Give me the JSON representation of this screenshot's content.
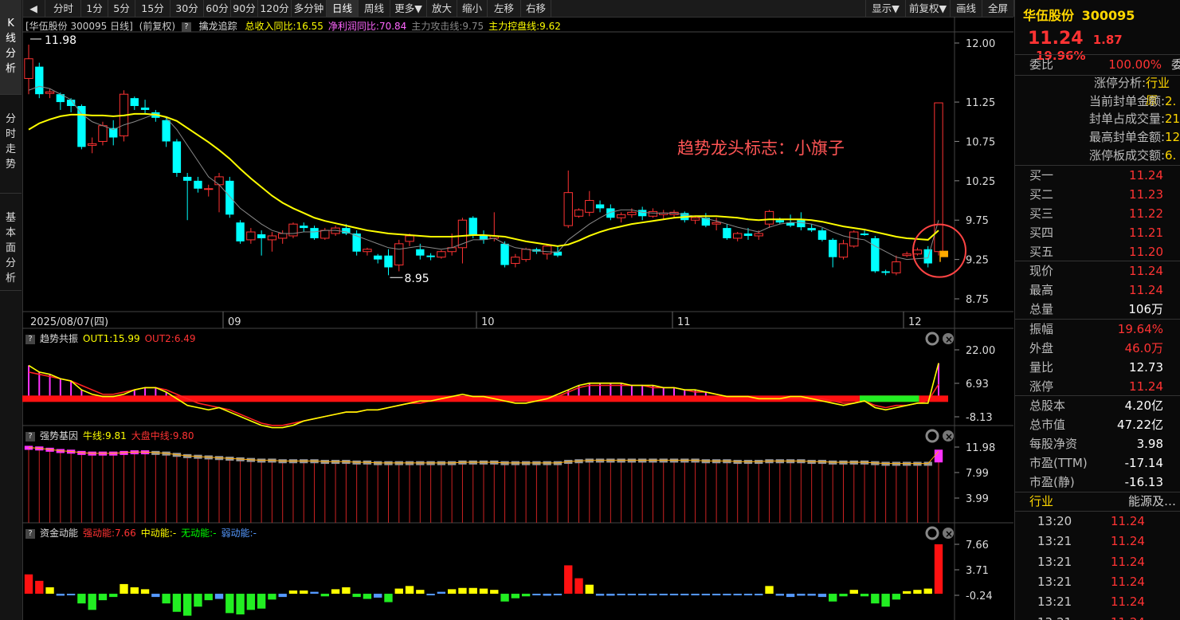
{
  "toolbar": {
    "back": "◀",
    "buttons": [
      "分时",
      "1分",
      "5分",
      "15分",
      "30分",
      "60分",
      "90分",
      "120分",
      "多分钟",
      "日线",
      "周线",
      "更多▼",
      "放大",
      "缩小",
      "左移",
      "右移"
    ],
    "right": [
      "显示▼",
      "前复权▼",
      "画线",
      "全屏"
    ]
  },
  "nav": [
    "K线分析",
    "分时走势",
    "基本面分析"
  ],
  "main_panel": {
    "title_prefix": "[华伍股份 300095 日线]",
    "adjust": "(前复权)",
    "indicator": "擒龙追踪",
    "legend": [
      {
        "text": "总收入同比:16.55",
        "color": "#ffff00"
      },
      {
        "text": "净利润同比:70.84",
        "color": "#ff66ff"
      },
      {
        "text": "主力攻击线:9.75",
        "color": "#888888"
      },
      {
        "text": "主力控盘线:9.62",
        "color": "#ffff00"
      }
    ],
    "high_label": "11.98",
    "low_label": "8.95",
    "annotation": "趋势龙头标志：小旗子",
    "date_start": "2025/08/07(四)",
    "months": [
      "09",
      "10",
      "11",
      "12"
    ],
    "yticks": [
      "12.00",
      "11.25",
      "10.75",
      "10.25",
      "9.75",
      "9.25",
      "8.75"
    ]
  },
  "panel2": {
    "title": "趋势共振",
    "legend": [
      {
        "text": "OUT1:15.99",
        "color": "#ffff00"
      },
      {
        "text": "OUT2:6.49",
        "color": "#ff3333"
      }
    ],
    "yticks": [
      "22.00",
      "6.93",
      "-8.13"
    ]
  },
  "panel3": {
    "title": "强势基因",
    "legend": [
      {
        "text": "牛线:9.81",
        "color": "#ffff00"
      },
      {
        "text": "大盘中线:9.80",
        "color": "#ff3333"
      }
    ],
    "yticks": [
      "11.98",
      "7.99",
      "3.99"
    ]
  },
  "panel4": {
    "title": "资金动能",
    "legend": [
      {
        "text": "强动能:7.66",
        "color": "#ff3333"
      },
      {
        "text": "中动能:-",
        "color": "#ffff00"
      },
      {
        "text": "无动能:-",
        "color": "#00ff00"
      },
      {
        "text": "弱动能:-",
        "color": "#5599ff"
      }
    ],
    "yticks": [
      "7.66",
      "3.71",
      "-0.24"
    ]
  },
  "quote": {
    "name": "华伍股份",
    "code": "300095",
    "price": "11.24",
    "change": "1.87",
    "pct": "19.96%",
    "weibi_label": "委比",
    "weibi": "100.00%",
    "weibi_extra": "委",
    "limit": [
      {
        "label": "涨停分析:",
        "value": "行业原"
      },
      {
        "label": "当前封单金额:",
        "value": "2."
      },
      {
        "label": "封单占成交量:",
        "value": "21"
      },
      {
        "label": "最高封单金额:",
        "value": "12"
      },
      {
        "label": "涨停板成交额:",
        "value": "6."
      }
    ],
    "bids": [
      {
        "label": "买一",
        "value": "11.24"
      },
      {
        "label": "买二",
        "value": "11.23"
      },
      {
        "label": "买三",
        "value": "11.22"
      },
      {
        "label": "买四",
        "value": "11.21"
      },
      {
        "label": "买五",
        "value": "11.20"
      }
    ],
    "stats1": [
      {
        "label": "现价",
        "value": "11.24",
        "color": "#ff3333"
      },
      {
        "label": "最高",
        "value": "11.24",
        "color": "#ff3333"
      },
      {
        "label": "总量",
        "value": "106万",
        "color": "#ffffff"
      }
    ],
    "stats2": [
      {
        "label": "振幅",
        "value": "19.64%",
        "color": "#ff3333"
      },
      {
        "label": "外盘",
        "value": "46.0万",
        "color": "#ff3333"
      },
      {
        "label": "量比",
        "value": "12.73",
        "color": "#ffffff"
      },
      {
        "label": "涨停",
        "value": "11.24",
        "color": "#ff3333"
      }
    ],
    "stats3": [
      {
        "label": "总股本",
        "value": "4.20亿"
      },
      {
        "label": "总市值",
        "value": "47.22亿"
      },
      {
        "label": "每股净资",
        "value": "3.98"
      },
      {
        "label": "市盈(TTM)",
        "value": "-17.14"
      },
      {
        "label": "市盈(静)",
        "value": "-16.13"
      }
    ],
    "industry_label": "行业",
    "industry": "能源及…",
    "ticks": [
      {
        "time": "13:20",
        "price": "11.24"
      },
      {
        "time": "13:21",
        "price": "11.24"
      },
      {
        "time": "13:21",
        "price": "11.24"
      },
      {
        "time": "13:21",
        "price": "11.24"
      },
      {
        "time": "13:21",
        "price": "11.24"
      },
      {
        "time": "13:21",
        "price": "11.24"
      }
    ]
  },
  "chart_data": {
    "type": "candlestick",
    "ohlc": [
      [
        11.55,
        11.98,
        11.35,
        11.8
      ],
      [
        11.7,
        11.75,
        11.3,
        11.35
      ],
      [
        11.36,
        11.42,
        11.3,
        11.38
      ],
      [
        11.35,
        11.37,
        11.15,
        11.25
      ],
      [
        11.28,
        11.3,
        11.12,
        11.2
      ],
      [
        11.2,
        11.22,
        10.65,
        10.68
      ],
      [
        10.7,
        10.8,
        10.6,
        10.72
      ],
      [
        10.75,
        11.0,
        10.7,
        10.95
      ],
      [
        10.92,
        11.02,
        10.7,
        10.8
      ],
      [
        10.82,
        11.4,
        10.75,
        11.35
      ],
      [
        11.3,
        11.32,
        11.15,
        11.2
      ],
      [
        11.18,
        11.28,
        11.1,
        11.15
      ],
      [
        11.12,
        11.15,
        11.0,
        11.05
      ],
      [
        11.02,
        11.05,
        10.68,
        10.75
      ],
      [
        10.75,
        10.78,
        10.3,
        10.35
      ],
      [
        10.3,
        10.35,
        9.75,
        10.25
      ],
      [
        10.25,
        10.3,
        10.1,
        10.15
      ],
      [
        10.15,
        10.2,
        10.05,
        10.15
      ],
      [
        10.2,
        10.35,
        9.85,
        10.3
      ],
      [
        10.25,
        10.3,
        9.78,
        9.82
      ],
      [
        9.72,
        9.75,
        9.45,
        9.48
      ],
      [
        9.5,
        9.65,
        9.45,
        9.6
      ],
      [
        9.57,
        9.62,
        9.3,
        9.52
      ],
      [
        9.5,
        9.6,
        9.35,
        9.55
      ],
      [
        9.52,
        9.62,
        9.45,
        9.58
      ],
      [
        9.55,
        9.72,
        9.52,
        9.7
      ],
      [
        9.68,
        9.72,
        9.6,
        9.65
      ],
      [
        9.65,
        9.68,
        9.5,
        9.52
      ],
      [
        9.52,
        9.65,
        9.5,
        9.62
      ],
      [
        9.58,
        9.68,
        9.55,
        9.65
      ],
      [
        9.65,
        9.7,
        9.56,
        9.58
      ],
      [
        9.58,
        9.62,
        9.3,
        9.35
      ],
      [
        9.35,
        9.4,
        9.3,
        9.38
      ],
      [
        9.3,
        9.32,
        9.2,
        9.25
      ],
      [
        9.3,
        9.38,
        9.05,
        9.15
      ],
      [
        9.18,
        9.5,
        9.1,
        9.45
      ],
      [
        9.48,
        9.58,
        9.42,
        9.55
      ],
      [
        9.38,
        9.45,
        9.25,
        9.3
      ],
      [
        9.3,
        9.33,
        9.24,
        9.28
      ],
      [
        9.28,
        9.37,
        9.26,
        9.35
      ],
      [
        9.35,
        9.58,
        9.3,
        9.4
      ],
      [
        9.4,
        9.78,
        9.2,
        9.75
      ],
      [
        9.78,
        9.8,
        9.52,
        9.55
      ],
      [
        9.55,
        9.62,
        9.45,
        9.5
      ],
      [
        9.52,
        9.85,
        9.48,
        9.55
      ],
      [
        9.45,
        9.48,
        9.15,
        9.18
      ],
      [
        9.2,
        9.32,
        9.15,
        9.28
      ],
      [
        9.25,
        9.4,
        9.22,
        9.38
      ],
      [
        9.38,
        9.4,
        9.32,
        9.35
      ],
      [
        9.32,
        9.45,
        9.25,
        9.42
      ],
      [
        9.35,
        9.42,
        9.28,
        9.3
      ],
      [
        9.68,
        10.38,
        9.65,
        10.1
      ],
      [
        9.8,
        9.9,
        9.78,
        9.88
      ],
      [
        9.85,
        10.12,
        9.8,
        10.0
      ],
      [
        9.95,
        10.0,
        9.85,
        9.9
      ],
      [
        9.9,
        9.95,
        9.75,
        9.78
      ],
      [
        9.78,
        9.85,
        9.72,
        9.82
      ],
      [
        9.82,
        9.9,
        9.78,
        9.85
      ],
      [
        9.88,
        9.92,
        9.75,
        9.8
      ],
      [
        9.8,
        9.9,
        9.78,
        9.86
      ],
      [
        9.82,
        9.88,
        9.76,
        9.84
      ],
      [
        9.82,
        9.88,
        9.78,
        9.85
      ],
      [
        9.84,
        9.86,
        9.72,
        9.75
      ],
      [
        9.75,
        9.8,
        9.7,
        9.78
      ],
      [
        9.78,
        9.84,
        9.66,
        9.68
      ],
      [
        9.7,
        9.78,
        9.62,
        9.72
      ],
      [
        9.65,
        9.7,
        9.5,
        9.52
      ],
      [
        9.52,
        9.6,
        9.48,
        9.58
      ],
      [
        9.58,
        9.65,
        9.5,
        9.55
      ],
      [
        9.55,
        9.62,
        9.5,
        9.58
      ],
      [
        9.7,
        9.88,
        9.65,
        9.86
      ],
      [
        9.75,
        9.78,
        9.7,
        9.72
      ],
      [
        9.72,
        9.82,
        9.66,
        9.68
      ],
      [
        9.75,
        9.85,
        9.62,
        9.66
      ],
      [
        9.65,
        9.7,
        9.6,
        9.62
      ],
      [
        9.62,
        9.65,
        9.48,
        9.5
      ],
      [
        9.5,
        9.52,
        9.15,
        9.28
      ],
      [
        9.28,
        9.5,
        9.25,
        9.45
      ],
      [
        9.42,
        9.62,
        9.4,
        9.6
      ],
      [
        9.58,
        9.62,
        9.55,
        9.56
      ],
      [
        9.52,
        9.55,
        9.08,
        9.1
      ],
      [
        9.1,
        9.12,
        9.05,
        9.08
      ],
      [
        9.08,
        9.3,
        9.05,
        9.22
      ],
      [
        9.3,
        9.35,
        9.28,
        9.32
      ],
      [
        9.32,
        9.4,
        9.3,
        9.37
      ],
      [
        9.38,
        9.42,
        9.15,
        9.2
      ],
      [
        9.35,
        11.24,
        9.3,
        11.24
      ]
    ],
    "ma_control": [
      10.9,
      10.98,
      11.03,
      11.07,
      11.09,
      11.09,
      11.08,
      11.08,
      11.07,
      11.08,
      11.1,
      11.1,
      11.09,
      11.06,
      11.01,
      10.92,
      10.83,
      10.74,
      10.64,
      10.53,
      10.4,
      10.28,
      10.17,
      10.06,
      9.97,
      9.9,
      9.84,
      9.78,
      9.74,
      9.71,
      9.68,
      9.65,
      9.62,
      9.6,
      9.58,
      9.57,
      9.56,
      9.55,
      9.54,
      9.54,
      9.54,
      9.55,
      9.56,
      9.56,
      9.55,
      9.54,
      9.51,
      9.48,
      9.46,
      9.44,
      9.42,
      9.44,
      9.49,
      9.55,
      9.6,
      9.64,
      9.67,
      9.7,
      9.72,
      9.74,
      9.76,
      9.78,
      9.79,
      9.8,
      9.8,
      9.8,
      9.79,
      9.78,
      9.76,
      9.75,
      9.76,
      9.76,
      9.76,
      9.76,
      9.75,
      9.73,
      9.7,
      9.67,
      9.65,
      9.63,
      9.6,
      9.57,
      9.54,
      9.52,
      9.51,
      9.5,
      9.62
    ],
    "ma_attack": [
      11.4,
      11.45,
      11.42,
      11.35,
      11.28,
      11.1,
      11.0,
      10.95,
      10.9,
      10.96,
      11.0,
      11.05,
      11.1,
      11.05,
      10.9,
      10.7,
      10.5,
      10.3,
      10.2,
      10.05,
      9.9,
      9.8,
      9.7,
      9.62,
      9.58,
      9.58,
      9.6,
      9.6,
      9.62,
      9.62,
      9.6,
      9.55,
      9.5,
      9.45,
      9.4,
      9.38,
      9.4,
      9.42,
      9.4,
      9.38,
      9.4,
      9.45,
      9.5,
      9.5,
      9.52,
      9.45,
      9.4,
      9.38,
      9.36,
      9.35,
      9.34,
      9.5,
      9.6,
      9.7,
      9.78,
      9.85,
      9.88,
      9.88,
      9.85,
      9.84,
      9.84,
      9.84,
      9.82,
      9.8,
      9.77,
      9.74,
      9.7,
      9.66,
      9.63,
      9.6,
      9.66,
      9.7,
      9.72,
      9.72,
      9.7,
      9.66,
      9.6,
      9.55,
      9.52,
      9.5,
      9.42,
      9.35,
      9.28,
      9.25,
      9.26,
      9.27,
      9.75
    ],
    "trend_out1": [
      15,
      12,
      11,
      9,
      8,
      4,
      2,
      1,
      1,
      2,
      4,
      5,
      5,
      3,
      0,
      -3,
      -4,
      -5,
      -4,
      -6,
      -8,
      -10,
      -12,
      -13,
      -13,
      -12,
      -10,
      -9,
      -8,
      -7,
      -6,
      -6,
      -5,
      -5,
      -4,
      -3,
      -2,
      -1,
      -1,
      0,
      1,
      2,
      1,
      1,
      0,
      -1,
      -2,
      -2,
      -1,
      0,
      2,
      4,
      6,
      7,
      7,
      7,
      7,
      6,
      6,
      6,
      5,
      5,
      4,
      4,
      3,
      2,
      1,
      1,
      1,
      0,
      0,
      0,
      1,
      1,
      0,
      -1,
      -2,
      -3,
      -2,
      -1,
      -4,
      -5,
      -4,
      -3,
      -2,
      -2,
      16
    ],
    "trend_out2": [
      12,
      11,
      10,
      9,
      8,
      6,
      4,
      2,
      2,
      3,
      4,
      5,
      5,
      4,
      2,
      0,
      -2,
      -3,
      -4,
      -5,
      -7,
      -9,
      -11,
      -12,
      -12,
      -11,
      -10,
      -9,
      -8,
      -7,
      -6,
      -6,
      -5,
      -5,
      -4,
      -3,
      -2,
      -2,
      -1,
      0,
      1,
      1,
      1,
      1,
      0,
      -1,
      -1,
      -1,
      -1,
      0,
      1,
      3,
      5,
      6,
      6,
      6,
      6,
      6,
      6,
      5,
      5,
      5,
      4,
      3,
      3,
      2,
      1,
      1,
      1,
      0,
      0,
      0,
      0,
      0,
      0,
      0,
      -1,
      -2,
      -2,
      -1,
      -3,
      -4,
      -3,
      -3,
      -2,
      -1,
      6.5
    ],
    "strong_gene": [
      11.8,
      11.7,
      11.5,
      11.3,
      11.2,
      11.0,
      10.9,
      10.9,
      10.9,
      11.0,
      11.1,
      11.1,
      11.0,
      10.9,
      10.7,
      10.5,
      10.4,
      10.3,
      10.2,
      10.1,
      10.0,
      9.9,
      9.8,
      9.8,
      9.7,
      9.7,
      9.7,
      9.7,
      9.6,
      9.6,
      9.6,
      9.5,
      9.5,
      9.4,
      9.4,
      9.4,
      9.4,
      9.4,
      9.4,
      9.4,
      9.4,
      9.5,
      9.5,
      9.5,
      9.5,
      9.4,
      9.4,
      9.4,
      9.4,
      9.4,
      9.4,
      9.6,
      9.7,
      9.8,
      9.8,
      9.8,
      9.8,
      9.8,
      9.8,
      9.8,
      9.8,
      9.8,
      9.8,
      9.8,
      9.7,
      9.7,
      9.7,
      9.6,
      9.6,
      9.6,
      9.7,
      9.7,
      9.7,
      9.7,
      9.6,
      9.6,
      9.5,
      9.5,
      9.5,
      9.5,
      9.4,
      9.3,
      9.3,
      9.3,
      9.3,
      9.3,
      11.2
    ],
    "fund_power": [
      3,
      2,
      1,
      -0.3,
      -0.2,
      -1.5,
      -2.5,
      -1,
      -0.5,
      1.5,
      1,
      0.7,
      -0.5,
      -1.5,
      -2.8,
      -3.4,
      -2,
      -1,
      -0.8,
      -3,
      -3.2,
      -2.5,
      -2.3,
      -0.9,
      -0.5,
      0.5,
      0.5,
      0.3,
      -0.4,
      0.7,
      1,
      -0.5,
      -0.8,
      -0.6,
      -1.3,
      0.8,
      1.2,
      0.6,
      -0.2,
      0.3,
      0.7,
      0.9,
      0.9,
      0.8,
      0.6,
      -1.2,
      -0.7,
      -0.4,
      -0.2,
      -0.3,
      -0.2,
      4.4,
      2.4,
      1.4,
      -0.3,
      -0.3,
      -0.2,
      -0.2,
      -0.2,
      -0.2,
      -0.2,
      -0.2,
      -0.2,
      -0.2,
      -0.2,
      -0.2,
      -0.2,
      -0.2,
      -0.2,
      -0.2,
      1.2,
      -0.3,
      -0.5,
      -0.3,
      -0.3,
      -0.5,
      -1.2,
      -0.4,
      0.6,
      -0.4,
      -1.5,
      -2,
      -0.9,
      0.4,
      0.6,
      0.8,
      7.66
    ]
  }
}
